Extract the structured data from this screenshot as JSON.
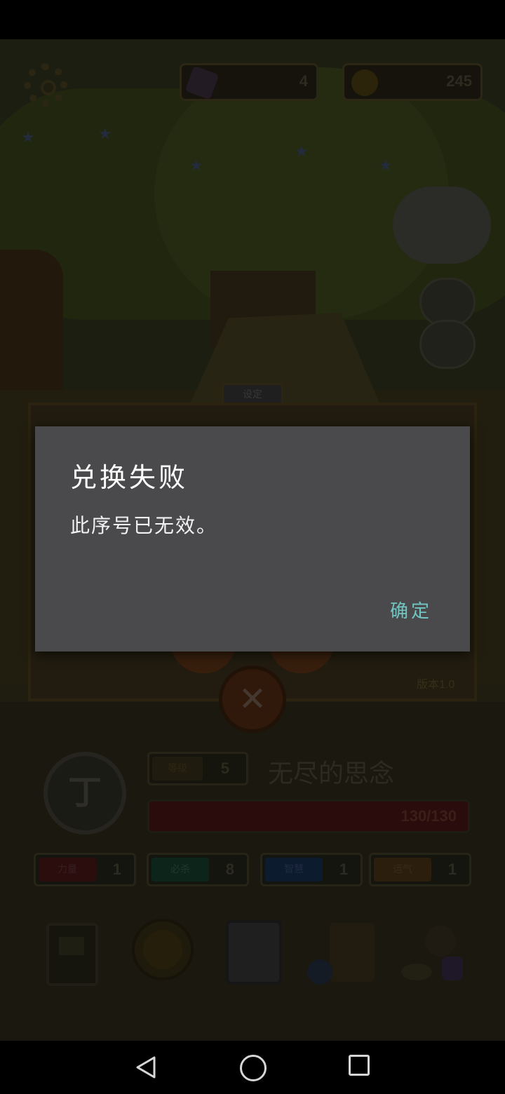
{
  "hud": {
    "gems": "4",
    "coins": "245"
  },
  "settings_panel": {
    "tab_label": "设定",
    "version": "版本1.0"
  },
  "character": {
    "coin_glyph": "丁",
    "level_label": "等级",
    "level": "5",
    "name": "无尽的思念",
    "hp": "130/130",
    "stats": [
      {
        "label": "力量",
        "value": "1",
        "color": "#4a1414"
      },
      {
        "label": "必杀",
        "value": "8",
        "color": "#143a2e"
      },
      {
        "label": "智慧",
        "value": "1",
        "color": "#142a4a"
      },
      {
        "label": "运气",
        "value": "1",
        "color": "#4a3010"
      }
    ]
  },
  "dialog": {
    "title": "兑换失败",
    "message": "此序号已无效。",
    "confirm": "确定"
  },
  "navbar": {
    "back": "back-icon",
    "home": "home-icon",
    "recent": "recent-apps-icon"
  }
}
